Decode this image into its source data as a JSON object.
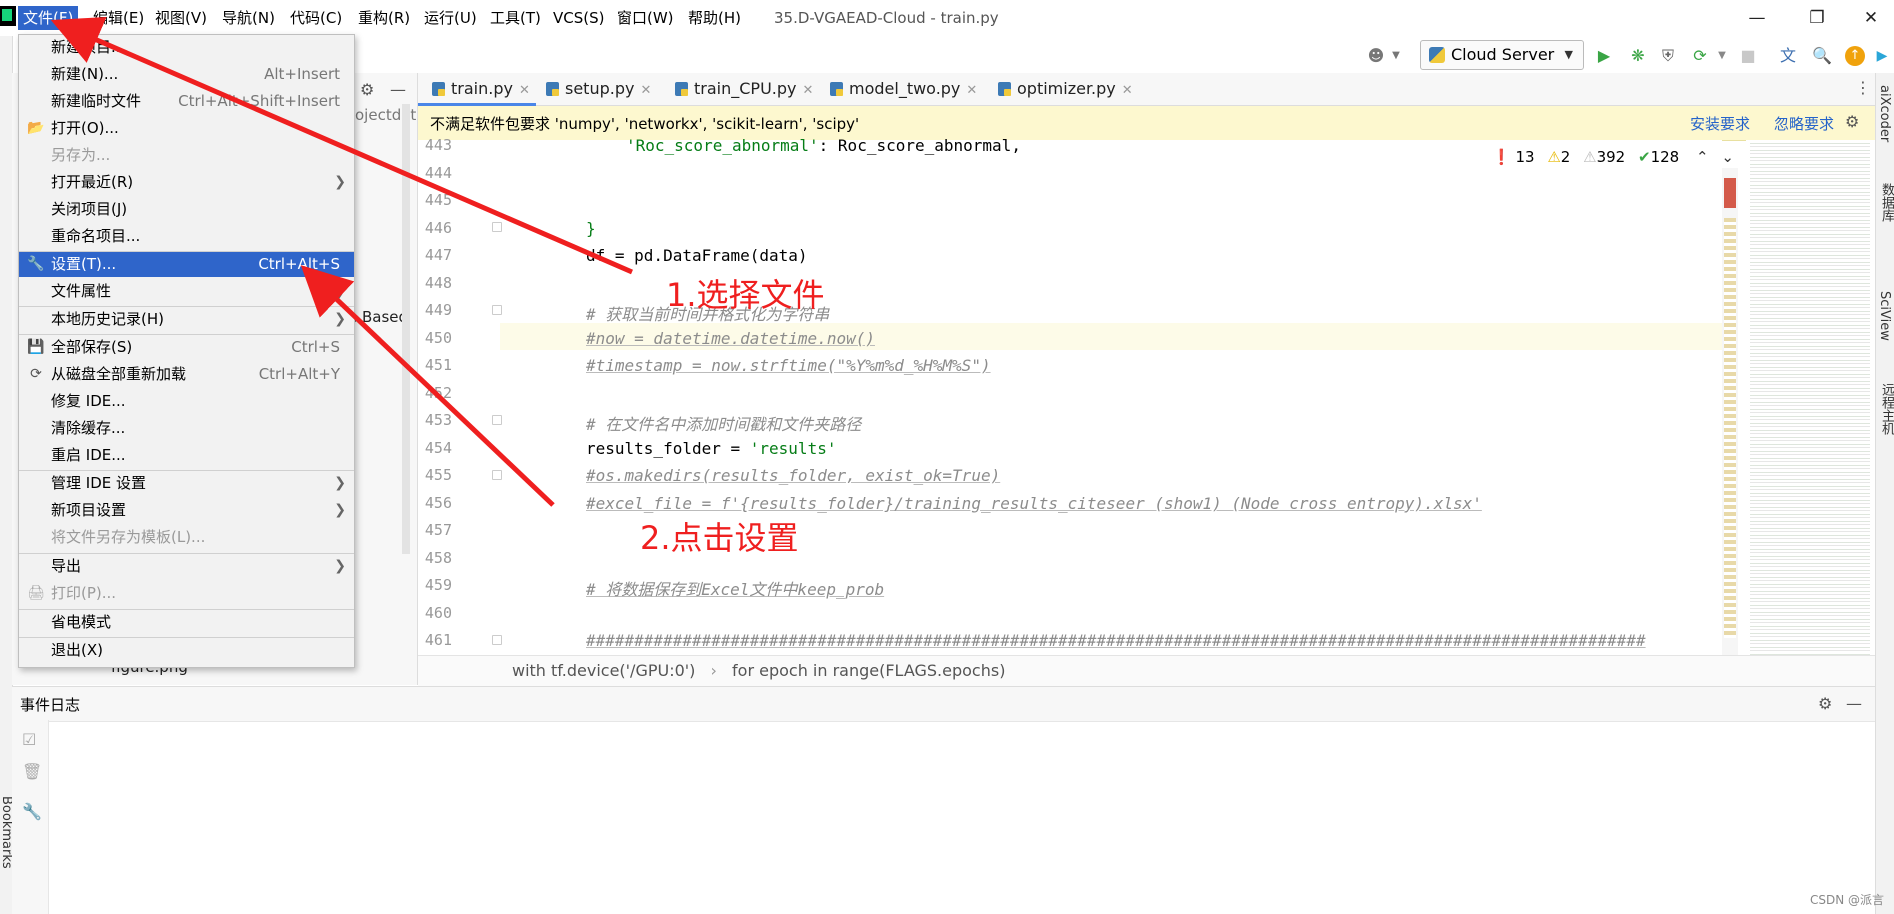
{
  "window": {
    "title": "35.D-VGAEAD-Cloud - train.py",
    "menus": [
      "文件(F)",
      "编辑(E)",
      "视图(V)",
      "导航(N)",
      "代码(C)",
      "重构(R)",
      "运行(U)",
      "工具(T)",
      "VCS(S)",
      "窗口(W)",
      "帮助(H)"
    ],
    "controls": {
      "minimize": "—",
      "restore": "❐",
      "close": "✕"
    }
  },
  "toolbar": {
    "run_config": "Cloud Server",
    "icons": [
      "user-icon",
      "run-icon",
      "debug-icon",
      "coverage-icon",
      "profile-icon",
      "stop-icon",
      "translate-icon",
      "search-icon",
      "update-icon",
      "plugin-icon"
    ]
  },
  "file_menu": {
    "items": [
      {
        "label": "新建项目...",
        "shortcut": "",
        "disabled": false,
        "submenu": false,
        "icon": ""
      },
      {
        "label": "新建(N)...",
        "shortcut": "Alt+Insert",
        "disabled": false,
        "submenu": false,
        "icon": ""
      },
      {
        "label": "新建临时文件",
        "shortcut": "Ctrl+Alt+Shift+Insert",
        "disabled": false,
        "submenu": false,
        "icon": ""
      },
      {
        "label": "打开(O)...",
        "shortcut": "",
        "disabled": false,
        "submenu": false,
        "icon": "folder-icon"
      },
      {
        "label": "另存为...",
        "shortcut": "",
        "disabled": true,
        "submenu": false,
        "icon": ""
      },
      {
        "label": "打开最近(R)",
        "shortcut": "",
        "disabled": false,
        "submenu": true,
        "icon": ""
      },
      {
        "label": "关闭项目(J)",
        "shortcut": "",
        "disabled": false,
        "submenu": false,
        "icon": ""
      },
      {
        "label": "重命名项目...",
        "shortcut": "",
        "disabled": false,
        "submenu": false,
        "icon": ""
      },
      {
        "label": "设置(T)...",
        "shortcut": "Ctrl+Alt+S",
        "disabled": false,
        "submenu": false,
        "icon": "wrench-icon",
        "selected": true
      },
      {
        "label": "文件属性",
        "shortcut": "",
        "disabled": false,
        "submenu": true,
        "icon": ""
      },
      {
        "label": "本地历史记录(H)",
        "shortcut": "",
        "disabled": false,
        "submenu": true,
        "icon": ""
      },
      {
        "label": "全部保存(S)",
        "shortcut": "Ctrl+S",
        "disabled": false,
        "submenu": false,
        "icon": "save-icon"
      },
      {
        "label": "从磁盘全部重新加载",
        "shortcut": "Ctrl+Alt+Y",
        "disabled": false,
        "submenu": false,
        "icon": "reload-icon"
      },
      {
        "label": "修复 IDE...",
        "shortcut": "",
        "disabled": false,
        "submenu": false,
        "icon": ""
      },
      {
        "label": "清除缓存...",
        "shortcut": "",
        "disabled": false,
        "submenu": false,
        "icon": ""
      },
      {
        "label": "重启 IDE...",
        "shortcut": "",
        "disabled": false,
        "submenu": false,
        "icon": ""
      },
      {
        "label": "管理 IDE 设置",
        "shortcut": "",
        "disabled": false,
        "submenu": true,
        "icon": ""
      },
      {
        "label": "新项目设置",
        "shortcut": "",
        "disabled": false,
        "submenu": true,
        "icon": ""
      },
      {
        "label": "将文件另存为模板(L)...",
        "shortcut": "",
        "disabled": true,
        "submenu": false,
        "icon": ""
      },
      {
        "label": "导出",
        "shortcut": "",
        "disabled": false,
        "submenu": true,
        "icon": ""
      },
      {
        "label": "打印(P)...",
        "shortcut": "",
        "disabled": true,
        "submenu": false,
        "icon": "print-icon"
      },
      {
        "label": "省电模式",
        "shortcut": "",
        "disabled": false,
        "submenu": false,
        "icon": ""
      },
      {
        "label": "退出(X)",
        "shortcut": "",
        "disabled": false,
        "submenu": false,
        "icon": ""
      }
    ]
  },
  "project_panel": {
    "fragment": "ojectdat",
    "based_text": "e Based",
    "file": "figure.png"
  },
  "tabs": [
    {
      "label": "train.py",
      "active": true
    },
    {
      "label": "setup.py",
      "active": false
    },
    {
      "label": "train_CPU.py",
      "active": false
    },
    {
      "label": "model_two.py",
      "active": false
    },
    {
      "label": "optimizer.py",
      "active": false
    }
  ],
  "notification": {
    "text": "不满足软件包要求 'numpy', 'networkx', 'scikit-learn', 'scipy'",
    "install": "安装要求",
    "ignore": "忽略要求"
  },
  "inspection": {
    "errors": "13",
    "warnings": "2",
    "weak_warnings": "392",
    "typos": "128"
  },
  "code": {
    "line_numbers": [
      "443",
      "444",
      "445",
      "446",
      "447",
      "448",
      "449",
      "450",
      "451",
      "452",
      "453",
      "454",
      "455",
      "456",
      "457",
      "458",
      "459",
      "460",
      "461"
    ],
    "l443_str": "'Roc_score_abnormal'",
    "l443_rest": ": Roc_score_abnormal,",
    "l446": "}",
    "l447": "df = pd.DataFrame(data)",
    "l449": "# 获取当前时间并格式化为字符串",
    "l450": "#now = datetime.datetime.now()",
    "l451": "#timestamp = now.strftime(\"%Y%m%d_%H%M%S\")",
    "l453": "# 在文件名中添加时间戳和文件夹路径",
    "l454_a": "results_folder = ",
    "l454_b": "'results'",
    "l455": "#os.makedirs(results_folder, exist_ok=True)",
    "l456": "#excel_file = f'{results_folder}/training_results_citeseer (show1) (Node cross entropy).xlsx'",
    "l459": "# 将数据保存到Excel文件中keep_prob",
    "l461": "##############################################################################################################"
  },
  "breadcrumb": {
    "first": "with tf.device('/GPU:0')",
    "separator": "›",
    "second": "for epoch in range(FLAGS.epochs)"
  },
  "event_log": {
    "title": "事件日志"
  },
  "right_strip": {
    "labels": [
      "aiXcoder",
      "数据库",
      "SciView",
      "远程主机"
    ]
  },
  "left_strip": {
    "bottom_label": "Bookmarks"
  },
  "annotations": {
    "step1": "1.选择文件",
    "step2": "2.点击设置",
    "color": "#ef1f1f"
  },
  "watermark": "CSDN @派言"
}
